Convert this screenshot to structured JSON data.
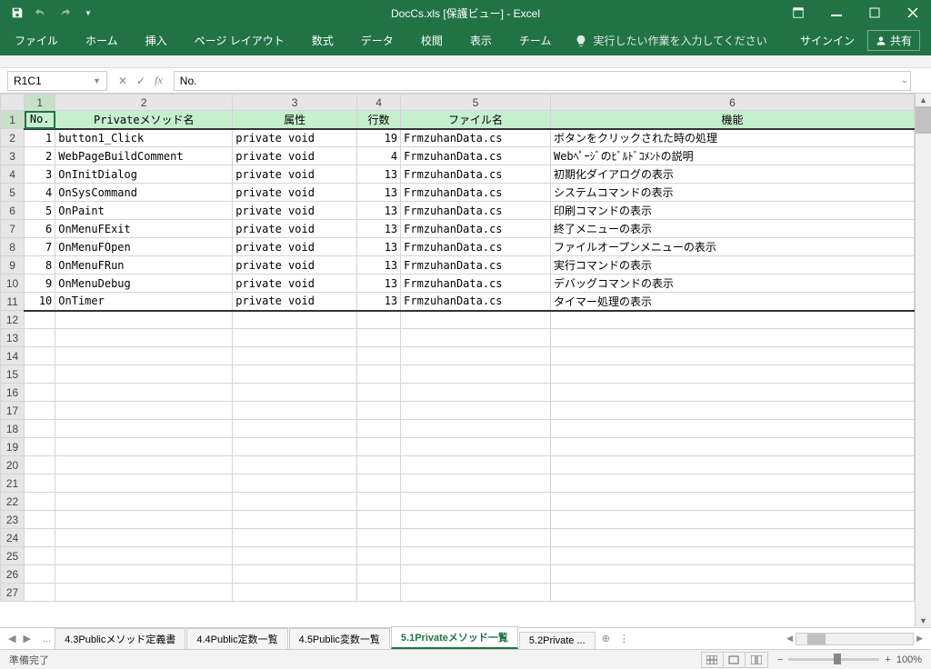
{
  "title": "DocCs.xls  [保護ビュー] - Excel",
  "qat": {
    "save": "save-icon",
    "undo": "undo-icon",
    "redo": "redo-icon"
  },
  "ribbon": {
    "tabs": [
      "ファイル",
      "ホーム",
      "挿入",
      "ページ レイアウト",
      "数式",
      "データ",
      "校閲",
      "表示",
      "チーム"
    ],
    "tellme": "実行したい作業を入力してください",
    "signin": "サインイン",
    "share": "共有"
  },
  "nameBox": "R1C1",
  "formula": "No.",
  "colHeaders": [
    "1",
    "2",
    "3",
    "4",
    "5",
    "6"
  ],
  "dataHeaders": [
    "No.",
    "Privateメソッド名",
    "属性",
    "行数",
    "ファイル名",
    "機能"
  ],
  "rows": [
    {
      "no": "1",
      "method": "button1_Click",
      "attr": "private void",
      "lines": "19",
      "file": "FrmzuhanData.cs",
      "func": "ボタンをクリックされた時の処理"
    },
    {
      "no": "2",
      "method": "WebPageBuildComment",
      "attr": "private void",
      "lines": "4",
      "file": "FrmzuhanData.cs",
      "func": "Webﾍﾟｰｼﾞのﾋﾞﾙﾄﾞｺﾒﾝﾄの説明"
    },
    {
      "no": "3",
      "method": "OnInitDialog",
      "attr": "private void",
      "lines": "13",
      "file": "FrmzuhanData.cs",
      "func": "初期化ダイアログの表示"
    },
    {
      "no": "4",
      "method": "OnSysCommand",
      "attr": "private void",
      "lines": "13",
      "file": "FrmzuhanData.cs",
      "func": "システムコマンドの表示"
    },
    {
      "no": "5",
      "method": "OnPaint",
      "attr": "private void",
      "lines": "13",
      "file": "FrmzuhanData.cs",
      "func": "印刷コマンドの表示"
    },
    {
      "no": "6",
      "method": "OnMenuFExit",
      "attr": "private void",
      "lines": "13",
      "file": "FrmzuhanData.cs",
      "func": "終了メニューの表示"
    },
    {
      "no": "7",
      "method": "OnMenuFOpen",
      "attr": "private void",
      "lines": "13",
      "file": "FrmzuhanData.cs",
      "func": "ファイルオープンメニューの表示"
    },
    {
      "no": "8",
      "method": "OnMenuFRun",
      "attr": "private void",
      "lines": "13",
      "file": "FrmzuhanData.cs",
      "func": "実行コマンドの表示"
    },
    {
      "no": "9",
      "method": "OnMenuDebug",
      "attr": "private void",
      "lines": "13",
      "file": "FrmzuhanData.cs",
      "func": "デバッグコマンドの表示"
    },
    {
      "no": "10",
      "method": "OnTimer",
      "attr": "private void",
      "lines": "13",
      "file": "FrmzuhanData.cs",
      "func": "タイマー処理の表示"
    }
  ],
  "emptyRows": 16,
  "sheetTabs": {
    "overflow": "...",
    "tabs": [
      "4.3Publicメソッド定義書",
      "4.4Public定数一覧",
      "4.5Public変数一覧",
      "5.1Privateメソッド一覧",
      "5.2Private ..."
    ],
    "active": 3
  },
  "status": "準備完了",
  "zoom": "100%"
}
